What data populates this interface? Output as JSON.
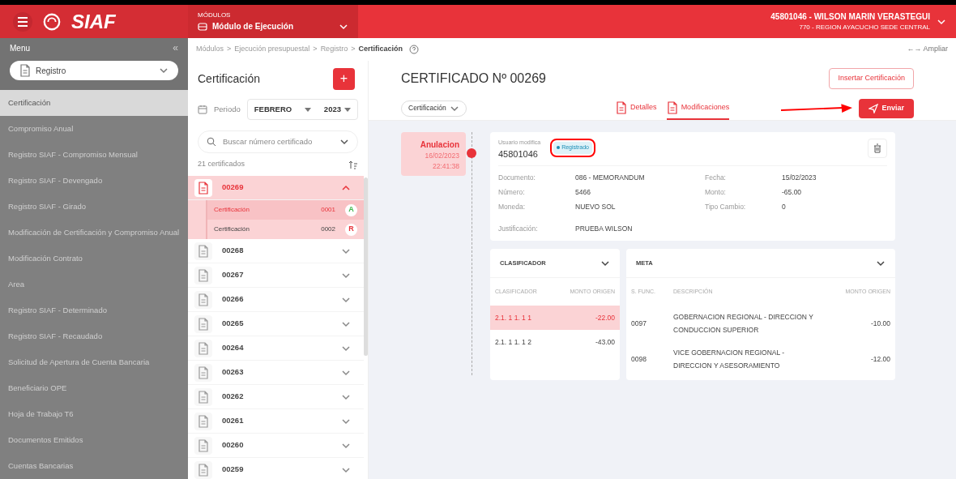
{
  "header": {
    "logo": "SIAF",
    "modules_label": "MÓDULOS",
    "module": "Módulo de Ejecución",
    "user": "45801046 - WILSON MARIN VERASTEGUI",
    "unit": "770 - REGION AYACUCHO SEDE CENTRAL"
  },
  "sidebar": {
    "title": "Menu",
    "collapse": "«",
    "dropdown": "Registro",
    "items": [
      {
        "label": "Certificación",
        "selected": true
      },
      {
        "label": "Compromiso Anual",
        "selected": false
      },
      {
        "label": "Registro SIAF - Compromiso Mensual",
        "selected": false
      },
      {
        "label": "Registro SIAF - Devengado",
        "selected": false
      },
      {
        "label": "Registro SIAF - Girado",
        "selected": false
      },
      {
        "label": "Modificación de Certificación y Compromiso Anual",
        "selected": false
      },
      {
        "label": "Modificación Contrato",
        "selected": false
      },
      {
        "label": "Area",
        "selected": false
      },
      {
        "label": "Registro SIAF - Determinado",
        "selected": false
      },
      {
        "label": "Registro SIAF - Recaudado",
        "selected": false
      },
      {
        "label": "Solicitud de Apertura de Cuenta Bancaria",
        "selected": false
      },
      {
        "label": "Beneficiario OPE",
        "selected": false
      },
      {
        "label": "Hoja de Trabajo T6",
        "selected": false
      },
      {
        "label": "Documentos Emitidos",
        "selected": false
      },
      {
        "label": "Cuentas Bancarias",
        "selected": false
      }
    ]
  },
  "breadcrumb": [
    "Módulos",
    ">",
    "Ejecución presupuestal",
    ">",
    "Registro",
    ">",
    "Certificación"
  ],
  "expand_link": "←→ Ampliar",
  "list": {
    "title": "Certificación",
    "add": "+",
    "period_label": "Periodo",
    "month": "FEBRERO",
    "year": "2023",
    "search_placeholder": "Buscar número certificado",
    "count": "21 certificados",
    "items": [
      {
        "number": "00269",
        "expanded": true,
        "children": [
          {
            "label": "Certificación",
            "code": "0001",
            "badge": "A",
            "selected": true,
            "color": "#3cb54a"
          },
          {
            "label": "Certificación",
            "code": "0002",
            "badge": "R",
            "selected": false,
            "color": "#e8333a"
          }
        ]
      },
      {
        "number": "00268",
        "expanded": false
      },
      {
        "number": "00267",
        "expanded": false
      },
      {
        "number": "00266",
        "expanded": false
      },
      {
        "number": "00265",
        "expanded": false
      },
      {
        "number": "00264",
        "expanded": false
      },
      {
        "number": "00263",
        "expanded": false
      },
      {
        "number": "00262",
        "expanded": false
      },
      {
        "number": "00261",
        "expanded": false
      },
      {
        "number": "00260",
        "expanded": false
      },
      {
        "number": "00259",
        "expanded": false
      }
    ]
  },
  "detail": {
    "title": "CERTIFICADO Nº 00269",
    "insert_button": "Insertar Certificación",
    "type_select": "Certificación",
    "tabs": [
      {
        "label": "Detalles",
        "selected": false
      },
      {
        "label": "Modificaciones",
        "selected": true
      }
    ],
    "send_button": "Enviar",
    "timeline": {
      "type": "Anulacion",
      "date": "16/02/2023",
      "time": "22:41:38"
    },
    "card": {
      "user_label": "Usuario modifica",
      "user": "45801046",
      "status": "Registrado",
      "fields": [
        {
          "label": "Documento:",
          "value": "086 - MEMORANDUM"
        },
        {
          "label": "Fecha:",
          "value": "15/02/2023"
        },
        {
          "label": "Número:",
          "value": "5466"
        },
        {
          "label": "Monto:",
          "value": "-65.00"
        },
        {
          "label": "Moneda:",
          "value": "NUEVO SOL"
        },
        {
          "label": "Tipo Cambio:",
          "value": "0"
        }
      ],
      "justification_label": "Justificación:",
      "justification": "PRUEBA WILSON"
    },
    "clasificador": {
      "title": "CLASIFICADOR",
      "columns": [
        "CLASIFICADOR",
        "MONTO ORIGEN"
      ],
      "rows": [
        {
          "code": "2.1. 1 1. 1 1",
          "amount": "-22.00",
          "selected": true
        },
        {
          "code": "2.1. 1 1. 1 2",
          "amount": "-43.00",
          "selected": false
        }
      ]
    },
    "meta": {
      "title": "META",
      "columns": [
        "S. FUNC.",
        "DESCRIPCIÓN",
        "MONTO ORIGEN"
      ],
      "rows": [
        {
          "func": "0097",
          "description": "GOBERNACION REGIONAL - DIRECCION Y CONDUCCION SUPERIOR",
          "amount": "-10.00"
        },
        {
          "func": "0098",
          "description": "VICE GOBERNACION REGIONAL - DIRECCION Y ASESORAMIENTO",
          "amount": "-12.00"
        }
      ]
    }
  }
}
